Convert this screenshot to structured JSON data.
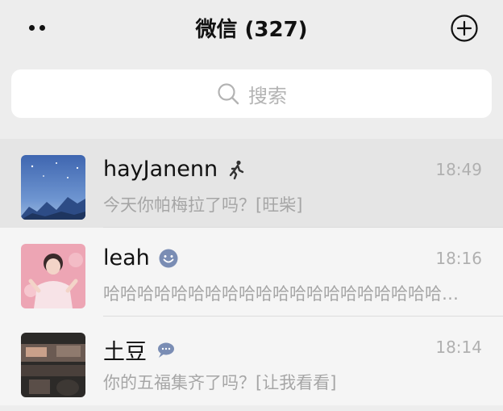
{
  "header": {
    "title": "微信 (327)"
  },
  "search": {
    "placeholder": "搜索"
  },
  "chats": [
    {
      "name": "hayJanenn",
      "status_icon": "running-person-icon",
      "time": "18:49",
      "message": "今天你帕梅拉了吗？[旺柴]"
    },
    {
      "name": "leah",
      "status_icon": "smiley-face-icon",
      "time": "18:16",
      "message": "哈哈哈哈哈哈哈哈哈哈哈哈哈哈哈哈哈哈哈哈哈哈哈哈"
    },
    {
      "name": "土豆",
      "status_icon": "chat-bubble-icon",
      "time": "18:14",
      "message": "你的五福集齐了吗？[让我看看]"
    }
  ],
  "colors": {
    "background": "#ededed",
    "row": "#f5f5f5",
    "row_active": "#e5e5e5",
    "secondary_text": "#a6a6a6"
  }
}
